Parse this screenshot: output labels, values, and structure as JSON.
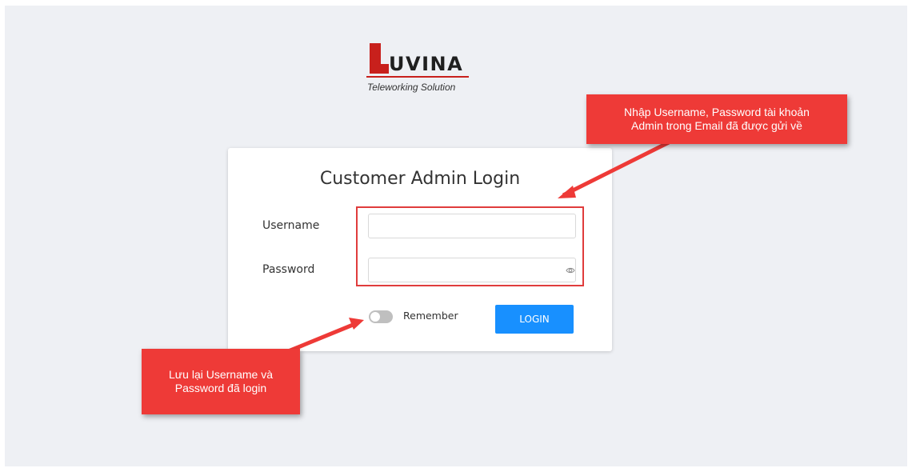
{
  "logo": {
    "brand": "UVINA",
    "tagline": "Teleworking Solution"
  },
  "login_card": {
    "title": "Customer Admin Login",
    "username_label": "Username",
    "username_value": "",
    "password_label": "Password",
    "password_value": "",
    "remember_label": "Remember",
    "remember_checked": false,
    "login_button": "LOGIN"
  },
  "annotations": {
    "top_callout_line1": "Nhập Username, Password tài khoản",
    "top_callout_line2": "Admin trong Email đã được gửi về",
    "bottom_callout_line1": "Lưu lại Username và",
    "bottom_callout_line2": "Password đã login"
  },
  "colors": {
    "background": "#eef0f4",
    "primary_button": "#1890ff",
    "annotation_red": "#ee3a37",
    "brand_red": "#c8201c"
  },
  "icons": {
    "password_toggle": "eye-icon"
  }
}
